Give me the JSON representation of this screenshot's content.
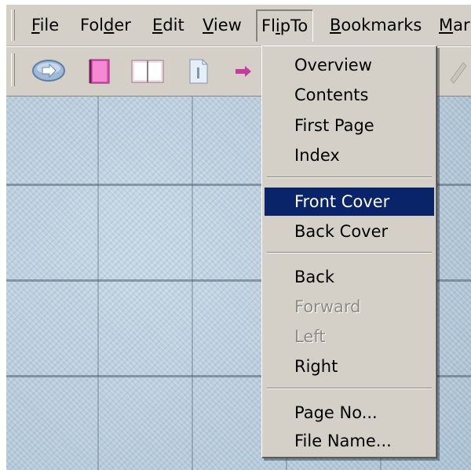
{
  "menubar": {
    "items": [
      {
        "pre": "",
        "u": "F",
        "post": "ile"
      },
      {
        "pre": "Fol",
        "u": "d",
        "post": "er"
      },
      {
        "pre": "",
        "u": "E",
        "post": "dit"
      },
      {
        "pre": "",
        "u": "V",
        "post": "iew"
      },
      {
        "pre": "Fl",
        "u": "i",
        "post": "pTo"
      },
      {
        "pre": "",
        "u": "B",
        "post": "ookmarks"
      },
      {
        "pre": "",
        "u": "M",
        "post": "ar"
      }
    ]
  },
  "toolbar": {
    "buttons": [
      "go-icon",
      "pink-book-icon",
      "open-book-icon",
      "page-icon",
      "arrow-page-icon",
      "pencil-icon"
    ]
  },
  "flipto_menu": {
    "groups": [
      [
        {
          "label": "Overview",
          "state": "normal"
        },
        {
          "label": "Contents",
          "state": "normal"
        },
        {
          "label": "First Page",
          "state": "normal"
        },
        {
          "label": "Index",
          "state": "normal"
        }
      ],
      [
        {
          "label": "Front Cover",
          "state": "selected"
        },
        {
          "label": "Back Cover",
          "state": "normal"
        }
      ],
      [
        {
          "label": "Back",
          "state": "normal"
        },
        {
          "label": "Forward",
          "state": "disabled"
        },
        {
          "label": "Left",
          "state": "disabled"
        },
        {
          "label": "Right",
          "state": "normal"
        }
      ],
      [
        {
          "label": "Page No...",
          "state": "normal"
        },
        {
          "label": "File Name...",
          "state": "normal"
        }
      ]
    ]
  },
  "colors": {
    "chrome": "#d4d0c8",
    "selection": "#0a246a",
    "workspace": "#b9cede"
  }
}
